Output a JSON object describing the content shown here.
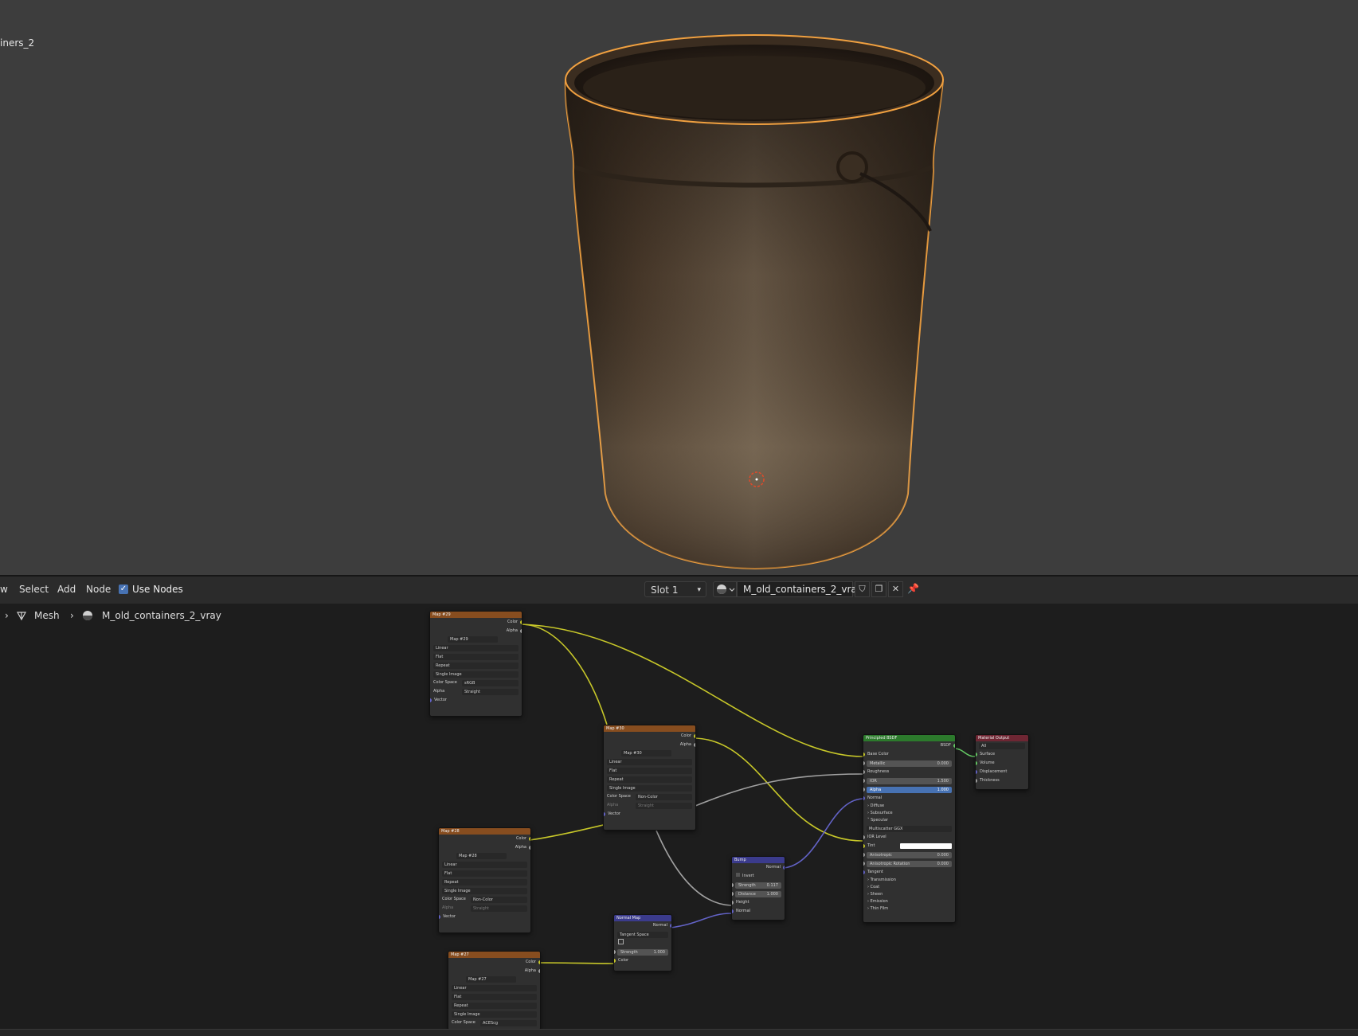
{
  "viewport": {
    "object_name": "iners_2"
  },
  "header": {
    "menu": [
      "w",
      "Select",
      "Add",
      "Node"
    ],
    "use_nodes": {
      "label": "Use Nodes",
      "checked": true
    },
    "slot": "Slot 1",
    "material_name": "M_old_containers_2_vray",
    "buttons": {
      "fake_user": "shield-icon",
      "duplicate": "copy-icon",
      "unlink": "close-icon",
      "pin": "pin-icon"
    }
  },
  "breadcrumb": {
    "items": [
      "Mesh",
      "M_old_containers_2_vray"
    ]
  },
  "nodes": {
    "map29": {
      "title": "Map #29",
      "out_color": "Color",
      "out_alpha": "Alpha",
      "image": "Map #29",
      "interp": "Linear",
      "proj": "Flat",
      "ext": "Repeat",
      "source": "Single Image",
      "cs_label": "Color Space",
      "cs_value": "sRGB",
      "alpha_label": "Alpha",
      "alpha_value": "Straight",
      "in_vector": "Vector"
    },
    "map30": {
      "title": "Map #30",
      "out_color": "Color",
      "out_alpha": "Alpha",
      "image": "Map #30",
      "interp": "Linear",
      "proj": "Flat",
      "ext": "Repeat",
      "source": "Single Image",
      "cs_label": "Color Space",
      "cs_value": "Non-Color",
      "alpha_label": "Alpha",
      "alpha_value": "Straight",
      "in_vector": "Vector"
    },
    "map28": {
      "title": "Map #28",
      "out_color": "Color",
      "out_alpha": "Alpha",
      "image": "Map #28",
      "interp": "Linear",
      "proj": "Flat",
      "ext": "Repeat",
      "source": "Single Image",
      "cs_label": "Color Space",
      "cs_value": "Non-Color",
      "alpha_label": "Alpha",
      "alpha_value": "Straight",
      "in_vector": "Vector"
    },
    "map27": {
      "title": "Map #27",
      "out_color": "Color",
      "out_alpha": "Alpha",
      "image": "Map #27",
      "interp": "Linear",
      "proj": "Flat",
      "ext": "Repeat",
      "source": "Single Image",
      "cs_label": "Color Space",
      "cs_value": "ACEScg"
    },
    "bump": {
      "title": "Bump",
      "out_normal": "Normal",
      "invert": "Invert",
      "strength_label": "Strength",
      "strength_value": "0.117",
      "distance_label": "Distance",
      "distance_value": "1.000",
      "in_height": "Height",
      "in_normal": "Normal"
    },
    "normalmap": {
      "title": "Normal Map",
      "out_normal": "Normal",
      "space": "Tangent Space",
      "strength_label": "Strength",
      "strength_value": "1.000",
      "in_color": "Color"
    },
    "bsdf": {
      "title": "Principled BSDF",
      "out_bsdf": "BSDF",
      "base_color": "Base Color",
      "metallic_label": "Metallic",
      "metallic_value": "0.000",
      "roughness": "Roughness",
      "ior_label": "IOR",
      "ior_value": "1.500",
      "alpha_label": "Alpha",
      "alpha_value": "1.000",
      "normal": "Normal",
      "diffuse": "Diffuse",
      "subsurface": "Subsurface",
      "specular": "Specular",
      "distribution": "Multiscatter GGX",
      "ior_level": "IOR Level",
      "tint": "Tint",
      "aniso_label": "Anisotropic",
      "aniso_value": "0.000",
      "aniso_rot_label": "Anisotropic Rotation",
      "aniso_rot_value": "0.000",
      "tangent": "Tangent",
      "transmission": "Transmission",
      "coat": "Coat",
      "sheen": "Sheen",
      "emission": "Emission",
      "thin_film": "Thin Film"
    },
    "output": {
      "title": "Material Output",
      "target": "All",
      "surface": "Surface",
      "volume": "Volume",
      "displacement": "Displacement",
      "thickness": "Thickness"
    }
  },
  "colors": {
    "selection_outline": "#f0a040",
    "texture_header": "#874d1f",
    "vector_header": "#3b3b8c",
    "shader_header": "#2c7a2c",
    "output_header": "#6e2633",
    "link_color": "#c7c729",
    "link_float": "#a1a1a1",
    "link_vector": "#6363c7",
    "link_shader": "#63c763"
  }
}
